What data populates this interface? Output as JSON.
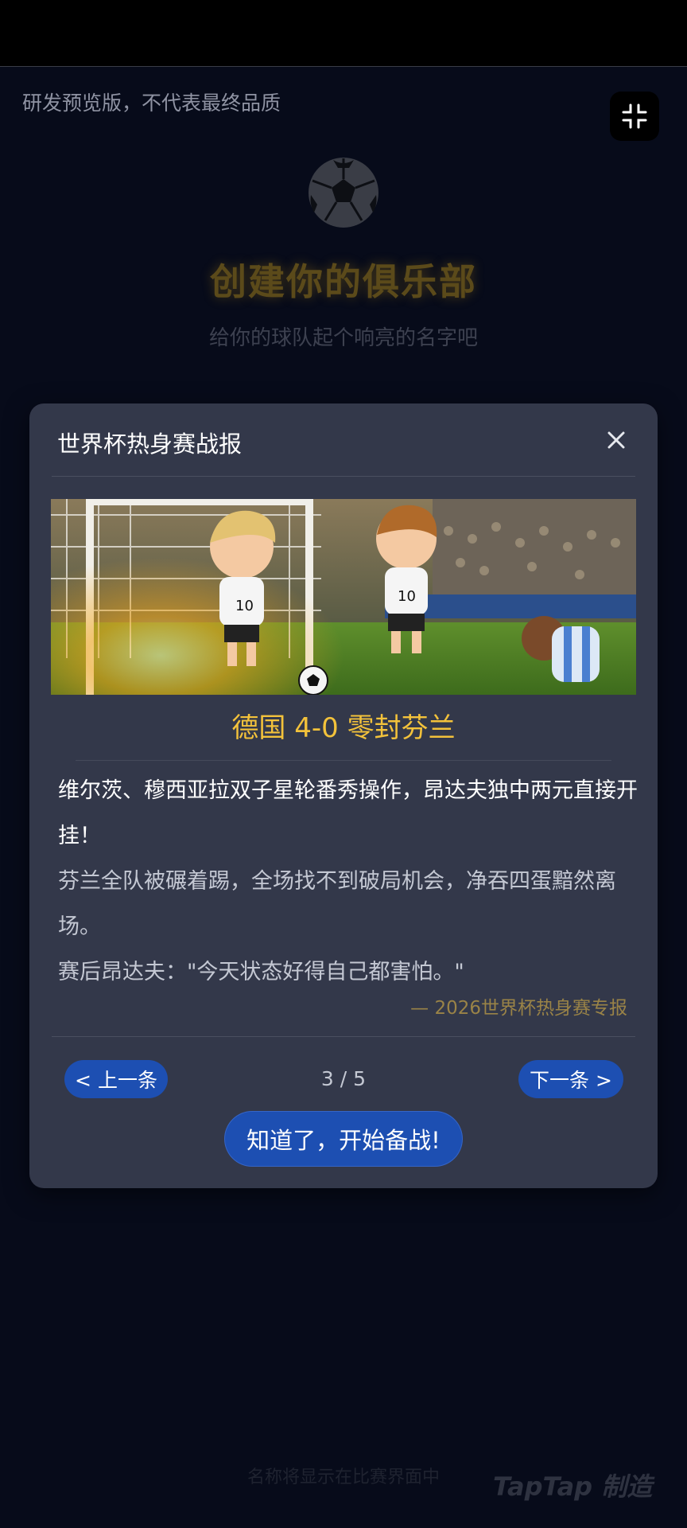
{
  "page": {
    "preview_note": "研发预览版，不代表最终品质",
    "background": {
      "title": "创建你的俱乐部",
      "subtitle": "给你的球队起个响亮的名字吧",
      "footnote": "名称将显示在比赛界面中",
      "watermark": "TapTap 制造"
    }
  },
  "icons": {
    "exit_fullscreen": "exit-fullscreen-icon",
    "close": "close-icon",
    "ball": "soccer-ball-icon"
  },
  "modal": {
    "title": "世界杯热身赛战报",
    "headline": "德国 4-0 零封芬兰",
    "lead": "维尔茨、穆西亚拉双子星轮番秀操作，昂达夫独中两元直接开挂！",
    "paragraph1": "芬兰全队被碾着踢，全场找不到破局机会，净吞四蛋黯然离场。",
    "paragraph2": "赛后昂达夫：\"今天状态好得自己都害怕。\"",
    "source": "— 2026世界杯热身赛专报",
    "prev_label": "< 上一条",
    "next_label": "下一条 >",
    "page_counter": "3 / 5",
    "confirm_label": "知道了，开始备战!"
  },
  "colors": {
    "background": "#070b1a",
    "modal": "#33384a",
    "accent_gold": "#f3c23b",
    "button_blue": "#1d4fb2"
  }
}
